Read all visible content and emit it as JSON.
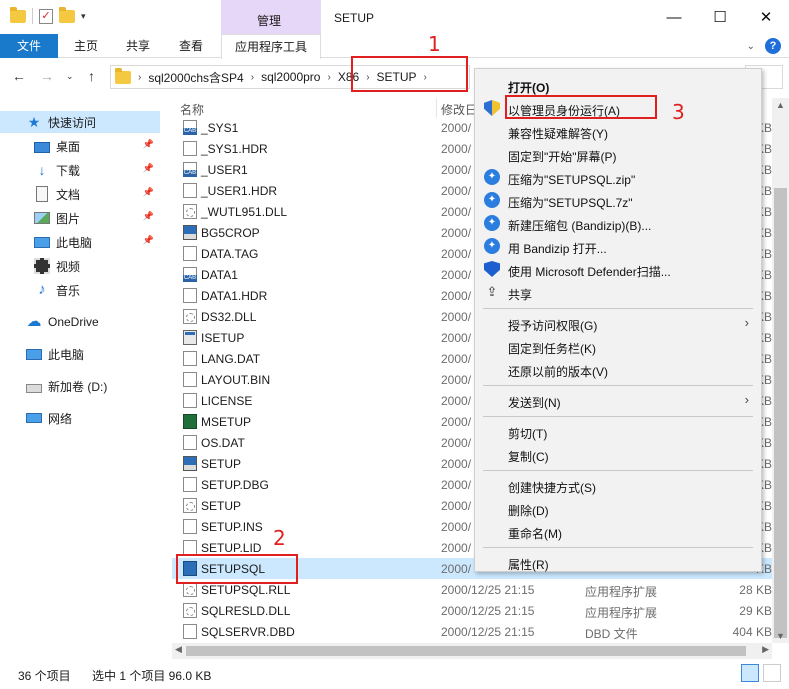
{
  "window": {
    "title": "SETUP",
    "manage_tab": "管理",
    "controls": {
      "minimize": "—",
      "maximize": "☐",
      "close": "✕"
    }
  },
  "ribbon": {
    "tabs": [
      "文件",
      "主页",
      "共享",
      "查看",
      "应用程序工具"
    ],
    "help": "?"
  },
  "address": {
    "crumbs": [
      "sql2000chs含SP4",
      "sql2000pro",
      "X86",
      "SETUP"
    ],
    "separator": "›"
  },
  "nav": {
    "items": [
      {
        "label": "快速访问",
        "icon": "star-icon",
        "pinned": false
      },
      {
        "label": "桌面",
        "icon": "desktop-icon",
        "pinned": true
      },
      {
        "label": "下载",
        "icon": "download-icon",
        "pinned": true
      },
      {
        "label": "文档",
        "icon": "document-icon",
        "pinned": true
      },
      {
        "label": "图片",
        "icon": "picture-icon",
        "pinned": true
      },
      {
        "label": "此电脑",
        "icon": "computer-icon",
        "pinned": true
      },
      {
        "label": "视频",
        "icon": "video-icon",
        "pinned": false
      },
      {
        "label": "音乐",
        "icon": "music-icon",
        "pinned": false
      },
      {
        "label": "OneDrive",
        "icon": "cloud-icon",
        "pinned": false
      },
      {
        "label": "此电脑",
        "icon": "computer-icon",
        "pinned": false
      },
      {
        "label": "新加卷 (D:)",
        "icon": "drive-icon",
        "pinned": false
      },
      {
        "label": "网络",
        "icon": "network-icon",
        "pinned": false
      }
    ]
  },
  "columns": {
    "name": "名称",
    "date": "修改日"
  },
  "files": [
    {
      "name": "_SYS1",
      "date": "2000/",
      "type": "",
      "size": "KB",
      "icon": "cab"
    },
    {
      "name": "_SYS1.HDR",
      "date": "2000/",
      "type": "",
      "size": "KB",
      "icon": "doc"
    },
    {
      "name": "_USER1",
      "date": "2000/",
      "type": "",
      "size": "KB",
      "icon": "cab"
    },
    {
      "name": "_USER1.HDR",
      "date": "2000/",
      "type": "",
      "size": "KB",
      "icon": "doc"
    },
    {
      "name": "_WUTL951.DLL",
      "date": "2000/",
      "type": "",
      "size": "KB",
      "icon": "dll"
    },
    {
      "name": "BG5CROP",
      "date": "2000/",
      "type": "",
      "size": "KB",
      "icon": "img"
    },
    {
      "name": "DATA.TAG",
      "date": "2000/",
      "type": "",
      "size": "KB",
      "icon": "doc"
    },
    {
      "name": "DATA1",
      "date": "2000/",
      "type": "",
      "size": "KB",
      "icon": "cab"
    },
    {
      "name": "DATA1.HDR",
      "date": "2000/",
      "type": "",
      "size": "KB",
      "icon": "doc"
    },
    {
      "name": "DS32.DLL",
      "date": "2000/",
      "type": "",
      "size": "KB",
      "icon": "dll"
    },
    {
      "name": "ISETUP",
      "date": "2000/",
      "type": "",
      "size": "KB",
      "icon": "app"
    },
    {
      "name": "LANG.DAT",
      "date": "2000/",
      "type": "",
      "size": "KB",
      "icon": "doc"
    },
    {
      "name": "LAYOUT.BIN",
      "date": "2000/",
      "type": "",
      "size": "KB",
      "icon": "doc"
    },
    {
      "name": "LICENSE",
      "date": "2000/",
      "type": "",
      "size": "KB",
      "icon": "doc"
    },
    {
      "name": "MSETUP",
      "date": "2000/",
      "type": "",
      "size": "KB",
      "icon": "ms"
    },
    {
      "name": "OS.DAT",
      "date": "2000/",
      "type": "",
      "size": "KB",
      "icon": "doc"
    },
    {
      "name": "SETUP",
      "date": "2000/",
      "type": "",
      "size": "KB",
      "icon": "img"
    },
    {
      "name": "SETUP.DBG",
      "date": "2000/",
      "type": "",
      "size": "KB",
      "icon": "doc"
    },
    {
      "name": "SETUP",
      "date": "2000/",
      "type": "",
      "size": "KB",
      "icon": "dll"
    },
    {
      "name": "SETUP.INS",
      "date": "2000/",
      "type": "",
      "size": "KB",
      "icon": "doc"
    },
    {
      "name": "SETUP.LID",
      "date": "2000/",
      "type": "",
      "size": "KB",
      "icon": "doc"
    },
    {
      "name": "SETUPSQL",
      "date": "2000/",
      "type": "",
      "size": "KB",
      "icon": "sql",
      "selected": true
    },
    {
      "name": "SETUPSQL.RLL",
      "date": "2000/12/25 21:15",
      "type": "应用程序扩展",
      "size": "28 KB",
      "icon": "dll"
    },
    {
      "name": "SQLRESLD.DLL",
      "date": "2000/12/25 21:15",
      "type": "应用程序扩展",
      "size": "29 KB",
      "icon": "dll"
    },
    {
      "name": "SQLSERVR.DBD",
      "date": "2000/12/25 21:15",
      "type": "DBD 文件",
      "size": "404 KB",
      "icon": "doc"
    }
  ],
  "status": {
    "count": "36 个项目",
    "selected": "选中 1 个项目 96.0 KB"
  },
  "context_menu": {
    "items": [
      {
        "label": "打开(O)",
        "icon": "",
        "bold": true
      },
      {
        "label": "以管理员身份运行(A)",
        "icon": "shield"
      },
      {
        "label": "兼容性疑难解答(Y)",
        "icon": ""
      },
      {
        "label": "固定到\"开始\"屏幕(P)",
        "icon": ""
      },
      {
        "label": "压缩为\"SETUPSQL.zip\"",
        "icon": "bz"
      },
      {
        "label": "压缩为\"SETUPSQL.7z\"",
        "icon": "bz"
      },
      {
        "label": "新建压缩包 (Bandizip)(B)...",
        "icon": "bz"
      },
      {
        "label": "用 Bandizip 打开...",
        "icon": "bz"
      },
      {
        "label": "使用 Microsoft Defender扫描...",
        "icon": "defender"
      },
      {
        "label": "共享",
        "icon": "share"
      },
      {
        "sep": true
      },
      {
        "label": "授予访问权限(G)",
        "icon": "",
        "arrow": true
      },
      {
        "label": "固定到任务栏(K)",
        "icon": ""
      },
      {
        "label": "还原以前的版本(V)",
        "icon": ""
      },
      {
        "sep": true
      },
      {
        "label": "发送到(N)",
        "icon": "",
        "arrow": true
      },
      {
        "sep": true
      },
      {
        "label": "剪切(T)",
        "icon": ""
      },
      {
        "label": "复制(C)",
        "icon": ""
      },
      {
        "sep": true
      },
      {
        "label": "创建快捷方式(S)",
        "icon": ""
      },
      {
        "label": "删除(D)",
        "icon": ""
      },
      {
        "label": "重命名(M)",
        "icon": ""
      },
      {
        "sep": true
      },
      {
        "label": "属性(R)",
        "icon": ""
      }
    ]
  },
  "annotations": {
    "step1": "1",
    "step2": "2",
    "step3": "3",
    "color": "#e02020"
  },
  "colors": {
    "accent": "#1979ca",
    "selection": "#cce8ff",
    "manage_tab": "#e6d6f7"
  }
}
